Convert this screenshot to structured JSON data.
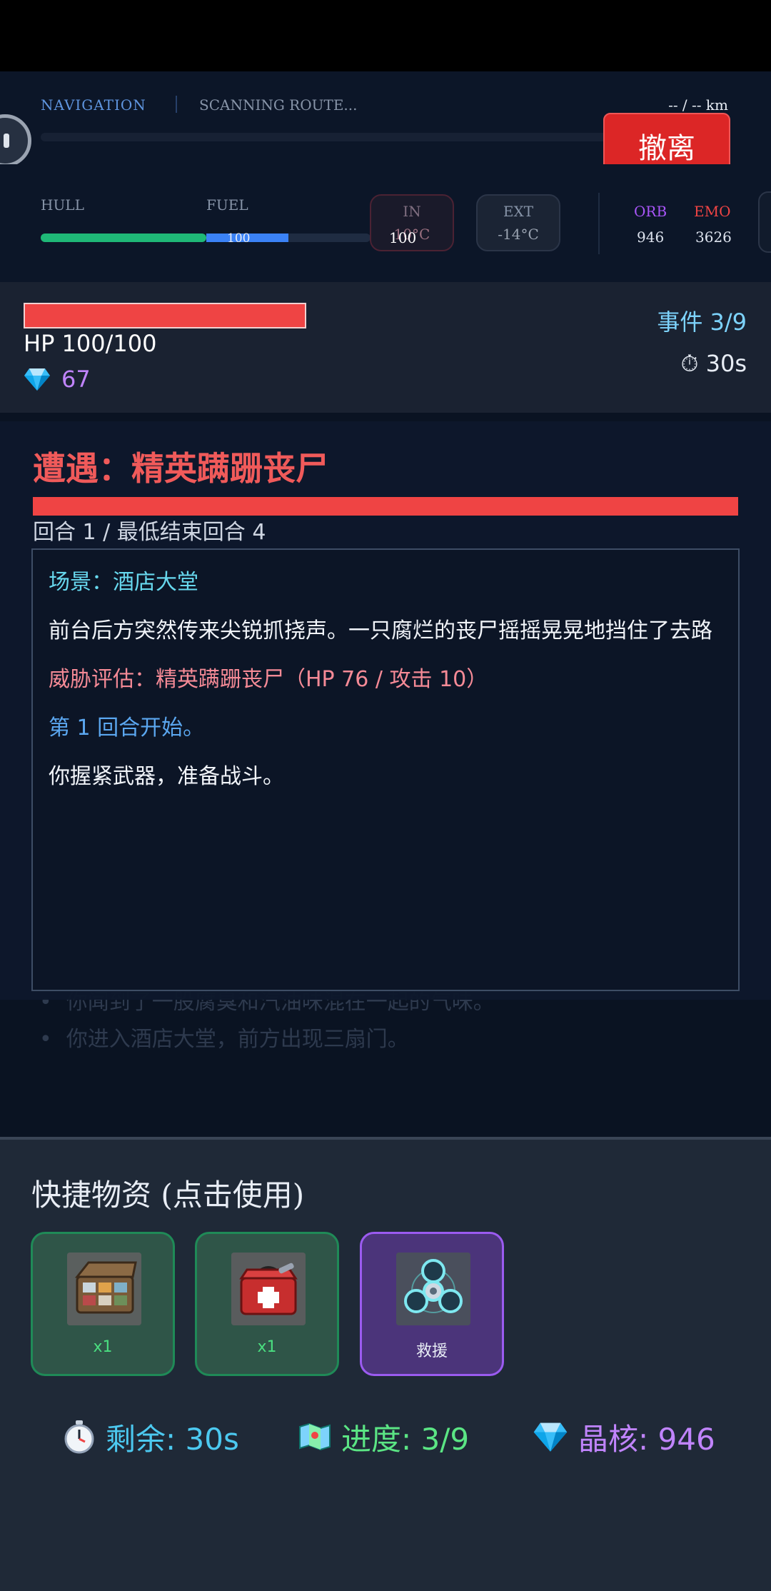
{
  "nav": {
    "label": "NAVIGATION",
    "status": "SCANNING ROUTE...",
    "distance": "-- / -- km"
  },
  "evac_button": "撤离",
  "stats": {
    "hull_label": "HULL",
    "fuel_label": "FUEL",
    "hull_value": "100",
    "fuel_value": "100",
    "fuel_level": 0.5,
    "temp_in_label": "IN",
    "temp_in_value": "10°C",
    "temp_ext_label": "EXT",
    "temp_ext_value": "-14°C",
    "orb_label": "ORB",
    "orb_value": "946",
    "emo_label": "EMO",
    "emo_value": "3626"
  },
  "player": {
    "hp_text": "HP 100/100",
    "hp_level": 1,
    "gems": "67",
    "event_counter": "事件 3/9",
    "timer": "⏱ 30s"
  },
  "combat": {
    "title": "遭遇：精英蹒跚丧尸",
    "round": "回合 1 / 最低结束回合 4",
    "log": {
      "scene": "场景：酒店大堂",
      "desc": "前台后方突然传来尖锐抓挠声。一只腐烂的丧尸摇摇晃晃地挡住了去路",
      "threat": "威胁评估：精英蹒跚丧尸（HP 76 / 攻击 10）",
      "round_start": "第 1 回合开始。",
      "ready": "你握紧武器，准备战斗。"
    }
  },
  "background_log": [
    "你闻到了一股腐臭和汽油味混在一起的气味。",
    "你进入酒店大堂，前方出现三扇门。"
  ],
  "quick": {
    "title": "快捷物资 (点击使用)",
    "items": [
      {
        "icon": "supply-case-icon",
        "count": "x1"
      },
      {
        "icon": "first-aid-kit-icon",
        "count": "x1"
      },
      {
        "icon": "fidget-spinner-icon",
        "count": "救援"
      }
    ]
  },
  "bottom_stats": {
    "time": "剩余: 30s",
    "progress": "进度: 3/9",
    "crystal": "晶核: 946"
  },
  "colors": {
    "danger": "#ef4444",
    "accent_blue": "#3b82f6",
    "hull_green": "#1fb877",
    "orb_purple": "#a855f7",
    "panel_bg": "#1f2937"
  }
}
